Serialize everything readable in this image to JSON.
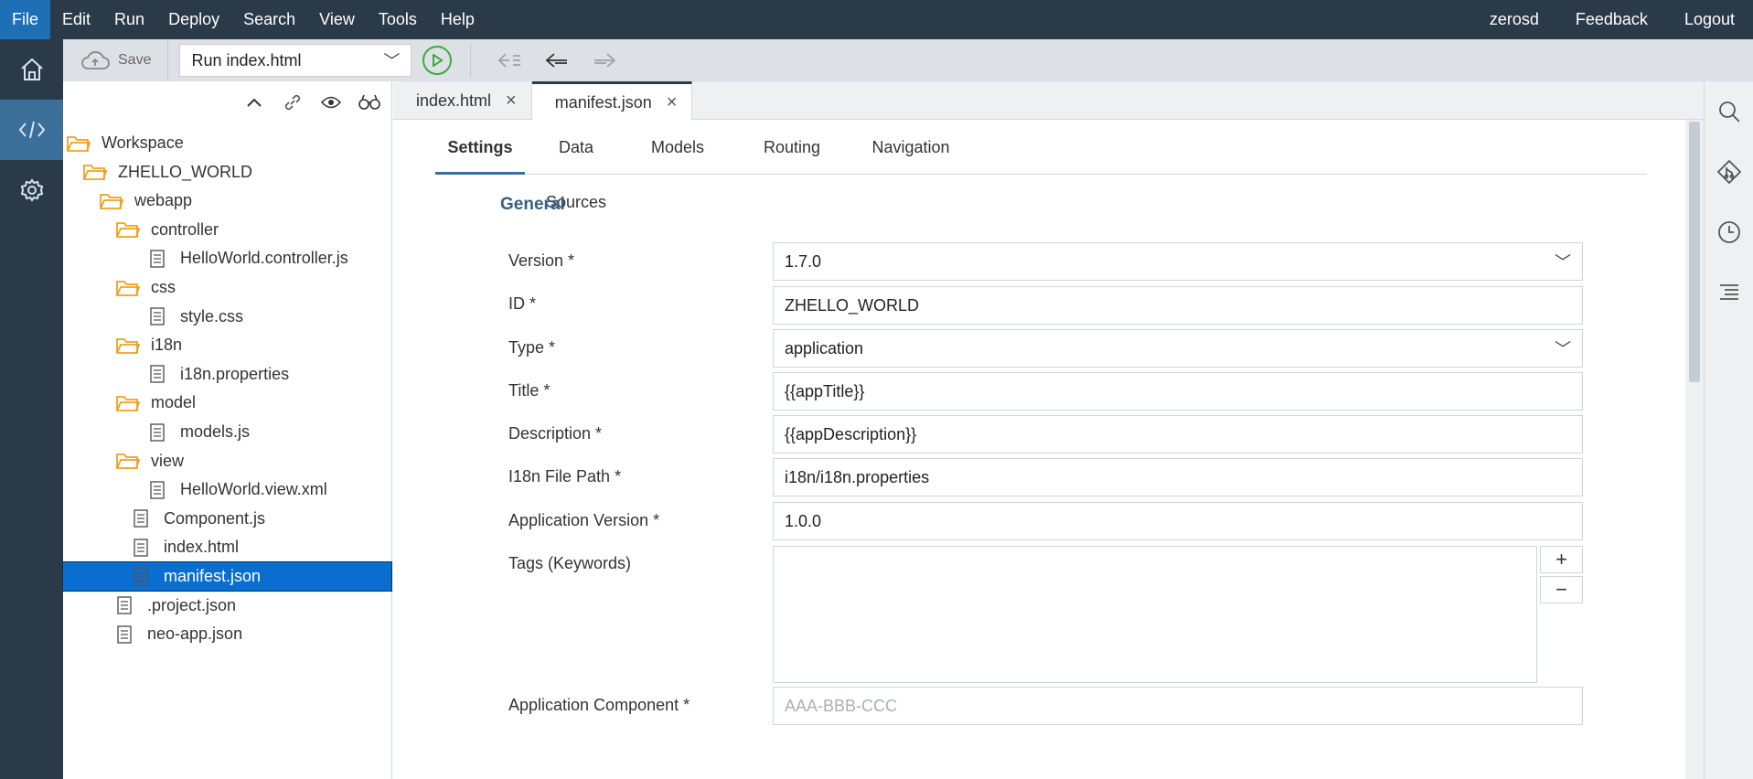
{
  "menu": {
    "items": [
      "File",
      "Edit",
      "Run",
      "Deploy",
      "Search",
      "View",
      "Tools",
      "Help"
    ],
    "active": "File",
    "right": [
      "zerosd",
      "Feedback",
      "Logout"
    ]
  },
  "activity_bar": {
    "items": [
      {
        "icon": "home-icon"
      },
      {
        "icon": "code-icon",
        "active": true
      },
      {
        "icon": "gear-icon"
      }
    ]
  },
  "toolbar": {
    "save_label": "Save",
    "run_config": "Run index.html"
  },
  "explorer": {
    "tree": [
      {
        "label": "Workspace",
        "type": "folder"
      },
      {
        "label": "ZHELLO_WORLD",
        "type": "folder"
      },
      {
        "label": "webapp",
        "type": "folder"
      },
      {
        "label": "controller",
        "type": "folder"
      },
      {
        "label": "HelloWorld.controller.js",
        "type": "file"
      },
      {
        "label": "css",
        "type": "folder"
      },
      {
        "label": "style.css",
        "type": "file"
      },
      {
        "label": "i18n",
        "type": "folder"
      },
      {
        "label": "i18n.properties",
        "type": "file"
      },
      {
        "label": "model",
        "type": "folder"
      },
      {
        "label": "models.js",
        "type": "file"
      },
      {
        "label": "view",
        "type": "folder"
      },
      {
        "label": "HelloWorld.view.xml",
        "type": "file"
      },
      {
        "label": "Component.js",
        "type": "file"
      },
      {
        "label": "index.html",
        "type": "file"
      },
      {
        "label": "manifest.json",
        "type": "file",
        "selected": true
      },
      {
        "label": ".project.json",
        "type": "file"
      },
      {
        "label": "neo-app.json",
        "type": "file"
      }
    ]
  },
  "editor_tabs": [
    {
      "label": "index.html",
      "active": false
    },
    {
      "label": "manifest.json",
      "active": true
    }
  ],
  "manifest": {
    "subtabs": [
      "Settings",
      "Data Sources",
      "Models",
      "Routing",
      "Navigation"
    ],
    "active_subtab": "Settings",
    "section_title": "General",
    "fields": {
      "version": {
        "label": "Version *",
        "value": "1.7.0"
      },
      "id": {
        "label": "ID *",
        "value": "ZHELLO_WORLD"
      },
      "type": {
        "label": "Type *",
        "value": "application"
      },
      "title": {
        "label": "Title *",
        "value": "{{appTitle}}"
      },
      "description": {
        "label": "Description *",
        "value": "{{appDescription}}"
      },
      "i18n_path": {
        "label": "I18n File Path *",
        "value": "i18n/i18n.properties"
      },
      "app_version": {
        "label": "Application Version *",
        "value": "1.0.0"
      },
      "tags": {
        "label": "Tags (Keywords)",
        "add": "+",
        "remove": "−"
      },
      "app_component": {
        "label": "Application Component *",
        "placeholder": "AAA-BBB-CCC"
      }
    }
  },
  "colors": {
    "menubar": "#2b3a48",
    "accent": "#0a6ed1",
    "folder": "#f0a01e",
    "section_title": "#346187",
    "run_green": "#3eaa3e"
  }
}
